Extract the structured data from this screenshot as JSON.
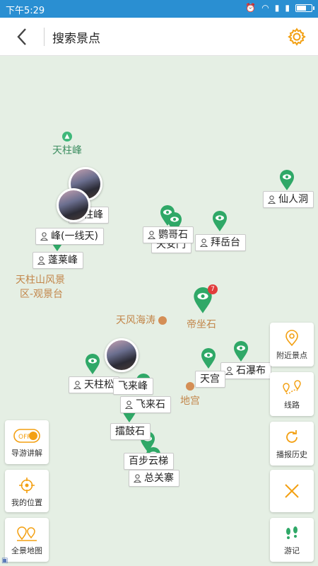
{
  "status": {
    "time": "下午5:29"
  },
  "header": {
    "title": "搜索景点"
  },
  "map": {
    "regions": [
      {
        "name": "天柱峰",
        "type": "peak"
      },
      {
        "name": "天柱山风景",
        "line2": "区-观景台"
      },
      {
        "name": "天风海涛"
      },
      {
        "name": "帝坐石"
      },
      {
        "name": "地宫"
      },
      {
        "name": "仙人洞"
      },
      {
        "name": "石瀑布"
      }
    ],
    "spots": [
      {
        "label": "仙人洞"
      },
      {
        "label": "天柱峰"
      },
      {
        "label": "峰(一线天)"
      },
      {
        "label": "鹦哥石"
      },
      {
        "label": "天安门"
      },
      {
        "label": "拜岳台"
      },
      {
        "label": "蓬莱峰"
      },
      {
        "label": "天宫"
      },
      {
        "label": "石瀑布"
      },
      {
        "label": "天柱松"
      },
      {
        "label": "飞来峰"
      },
      {
        "label": "飞来石"
      },
      {
        "label": "擂鼓石"
      },
      {
        "label": "百步云梯"
      },
      {
        "label": "总关寨"
      }
    ],
    "badge_count": "7"
  },
  "left_buttons": [
    {
      "label": "导游讲解",
      "toggle": "OFF"
    },
    {
      "label": "我的位置"
    },
    {
      "label": "全景地图"
    }
  ],
  "right_buttons": [
    {
      "label": "附近景点"
    },
    {
      "label": "线路"
    },
    {
      "label": "播报历史"
    },
    {
      "label": ""
    },
    {
      "label": "游记"
    }
  ],
  "colors": {
    "accent": "#2a8fd2",
    "pin": "#2fa867",
    "orange": "#f3a012"
  }
}
